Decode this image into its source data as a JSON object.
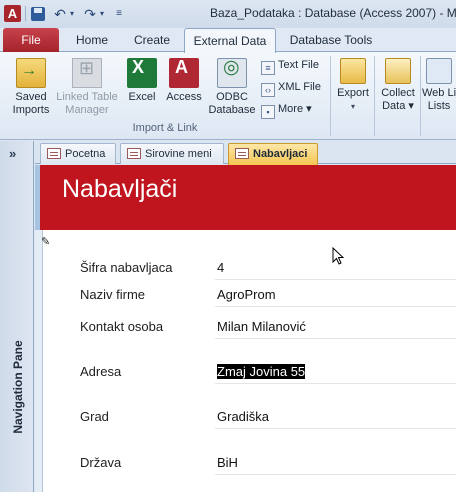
{
  "window": {
    "title": "Baza_Podataka : Database (Access 2007)  -  Micr",
    "app_icon": "A"
  },
  "qat": {
    "save_icon": "save-icon",
    "undo": "↶",
    "redo": "↷",
    "dropdown": "▾",
    "customize": "≡"
  },
  "ribbon_tabs": {
    "file": "File",
    "home": "Home",
    "create": "Create",
    "external": "External Data",
    "dbtools": "Database Tools"
  },
  "ribbon": {
    "saved_imports_l1": "Saved",
    "saved_imports_l2": "Imports",
    "linked_l1": "Linked Table",
    "linked_l2": "Manager",
    "excel": "Excel",
    "access": "Access",
    "odbc_l1": "ODBC",
    "odbc_l2": "Database",
    "text_file": "Text File",
    "xml_file": "XML File",
    "more": "More ▾",
    "group_import": "Import & Link",
    "export": "Export",
    "collect_l1": "Collect",
    "collect_l2": "Data ▾",
    "web_l1": "Web Li",
    "web_l2": "Lists"
  },
  "nav": {
    "toggle": "»",
    "label": "Navigation Pane"
  },
  "doc_tabs": {
    "pocetna": "Pocetna",
    "sirovine": "Sirovine meni",
    "nabavljaci": "Nabavljaci"
  },
  "form": {
    "title": "Nabavljači",
    "record_indicator": "✎",
    "fields": {
      "sifra_label": "Šifra nabavljaca",
      "sifra_value": "4",
      "naziv_label": "Naziv firme",
      "naziv_value": "AgroProm",
      "kontakt_label": "Kontakt osoba",
      "kontakt_value": "Milan Milanović",
      "adresa_label": "Adresa",
      "adresa_value": "Zmaj Jovina 55",
      "grad_label": "Grad",
      "grad_value": "Gradiška",
      "drzava_label": "Država",
      "drzava_value": "BiH"
    }
  }
}
